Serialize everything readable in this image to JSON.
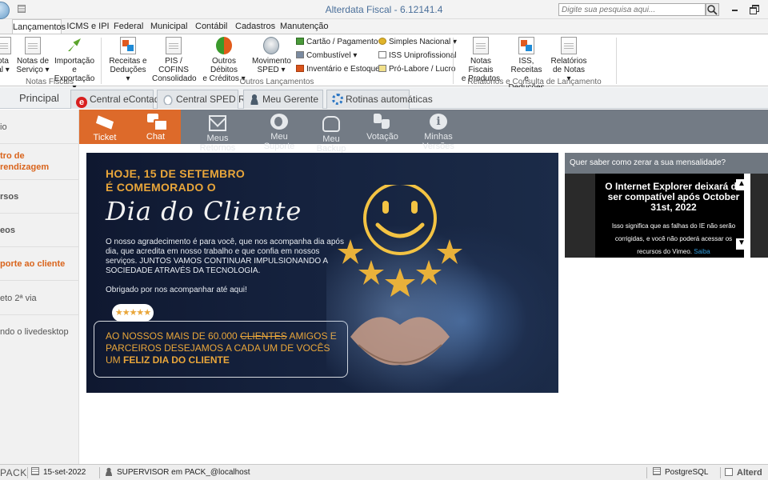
{
  "window": {
    "title": "Alterdata Fiscal - 6.12141.4",
    "search_placeholder": "Digite sua pesquisa aqui..."
  },
  "menu_tabs": [
    "Lançamentos",
    "ICMS e IPI",
    "Federal",
    "Municipal",
    "Contábil",
    "Cadastros",
    "Manutenção"
  ],
  "ribbon": {
    "notas_fiscais": {
      "group_label": "Notas Fiscais",
      "buttons": [
        {
          "line1": "ota",
          "line2": "al ▾"
        },
        {
          "line1": "Notas de",
          "line2": "Serviço ▾"
        },
        {
          "line1": "Importação e",
          "line2": "Exportação ▾"
        }
      ]
    },
    "outros_lancamentos": {
      "group_label": "Outros Lançamentos",
      "buttons": [
        {
          "line1": "Receitas e",
          "line2": "Deduções ▾"
        },
        {
          "line1": "PIS / COFINS",
          "line2": "Consolidado"
        },
        {
          "line1": "Outros Débitos",
          "line2": "e Créditos ▾"
        },
        {
          "line1": "Movimento",
          "line2": "SPED ▾"
        }
      ],
      "small_items": [
        "Cartão / Pagamento ▾",
        "Combustível ▾",
        "Inventário e Estoque ▾",
        "Simples Nacional ▾",
        "ISS Uniprofissional",
        "Pró-Labore / Lucro"
      ]
    },
    "relatorios": {
      "group_label": "Relatórios e Consulta de Lançamento",
      "buttons": [
        {
          "line1": "Notas Fiscais",
          "line2": "e Produtos"
        },
        {
          "line1": "ISS, Receitas",
          "line2": "e Deduções"
        },
        {
          "line1": "Relatórios",
          "line2": "de Notas ▾"
        }
      ]
    }
  },
  "doc_tabs": {
    "principal": "Principal",
    "tabs": [
      "Central eContador",
      "Central SPED Reinf",
      "Meu Gerente",
      "Rotinas automáticas"
    ]
  },
  "sidebar": {
    "items": [
      "io",
      "tro de",
      "rendizagem",
      "rsos",
      "eos",
      "porte ao cliente",
      "eto 2ª via",
      "ndo o livedesktop"
    ]
  },
  "services": [
    "Ticket",
    "Chat",
    "Meus Retornos",
    "Meu Suporte",
    "Meu Backup",
    "Votação",
    "Minhas Versões"
  ],
  "banner": {
    "headline1": "HOJE, 15 DE SETEMBRO",
    "headline2": "É COMEMORADO O",
    "script_title": "Dia do Cliente",
    "body": "O nosso agradecimento é para você, que nos acompanha dia após dia, que acredita em nosso trabalho e que confia em nossos serviços. JUNTOS VAMOS CONTINUAR IMPULSIONANDO A SOCIEDADE ATRAVÉS DA TECNOLOGIA.",
    "thanks": "Obrigado por nos acompanhar até aqui!",
    "rating_badge": "★★★★★",
    "box_part1": "AO NOSSOS MAIS DE 60.000 ",
    "box_strike": "CLIENTES",
    "box_part2": " AMIGOS E PARCEIROS DESEJAMOS A CADA UM DE VOCÊS UM ",
    "box_strong": "FELIZ DIA DO CLIENTE"
  },
  "video_panel": {
    "header": "Quer saber como zerar a sua mensalidade?",
    "title": "O Internet Explorer deixará de ser compatível após October 31st, 2022",
    "message": "Isso significa que as falhas do IE não serão corrigidas, e você não poderá acessar os recursos do Vimeo.",
    "link": "Saiba"
  },
  "statusbar": {
    "left_label": "PACK",
    "date": "15-set-2022",
    "user": "SUPERVISOR em PACK_@localhost",
    "db": "PostgreSQL",
    "brand": "Alterd"
  },
  "colors": {
    "accent_orange": "#dd6a2a",
    "service_bar": "#737b85",
    "banner_gold": "#e9a63a",
    "title_blue": "#4a6f9a"
  }
}
